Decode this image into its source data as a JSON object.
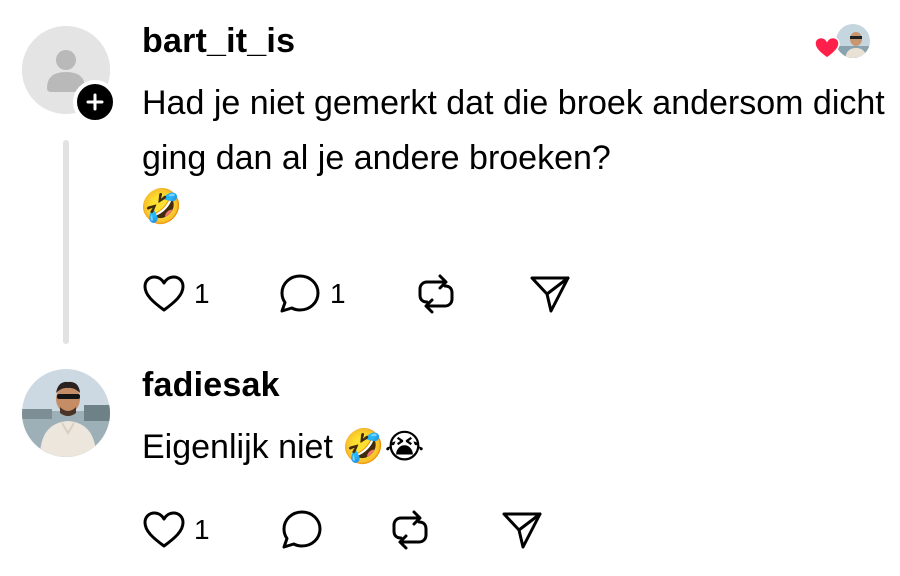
{
  "comments": [
    {
      "username": "bart_it_is",
      "text": "Had je niet gemerkt dat die broek andersom dicht ging dan al je andere broeken?",
      "emoji": "🤣",
      "avatar_icon": "default-user-icon",
      "follow_icon": "plus-icon",
      "liked_by_author": true,
      "actions": {
        "like_count": "1",
        "reply_count": "1"
      }
    },
    {
      "username": "fadiesak",
      "text": "Eigenlijk niet 🤣😭",
      "avatar_icon": "profile-photo",
      "actions": {
        "like_count": "1",
        "reply_count": ""
      }
    }
  ],
  "colors": {
    "heart": "#ff1f4b",
    "thread_line": "#e2e2e2",
    "badge": "#000000"
  }
}
